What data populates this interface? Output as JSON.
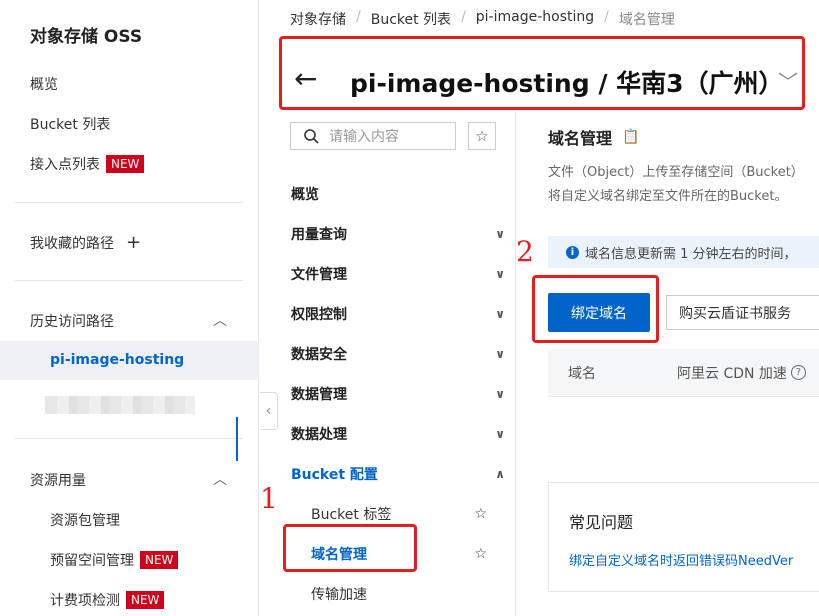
{
  "sidebar": {
    "title": "对象存储 OSS",
    "overview": "概览",
    "bucket_list": "Bucket 列表",
    "access_points": "接入点列表",
    "favorites": "我收藏的路径",
    "history": "历史访问路径",
    "history_active": "pi-image-hosting",
    "resource_usage": "资源用量",
    "resource_pack": "资源包管理",
    "reserved_space": "预留空间管理",
    "billing_check": "计费项检测",
    "new_badge": "NEW"
  },
  "breadcrumb": [
    "对象存储",
    "Bucket 列表",
    "pi-image-hosting",
    "域名管理"
  ],
  "header": {
    "title": "pi-image-hosting / 华南3（广州）"
  },
  "bucket_nav": {
    "search_placeholder": "请输入内容",
    "items": [
      {
        "label": "概览"
      },
      {
        "label": "用量查询"
      },
      {
        "label": "文件管理"
      },
      {
        "label": "权限控制"
      },
      {
        "label": "数据安全"
      },
      {
        "label": "数据管理"
      },
      {
        "label": "数据处理"
      },
      {
        "label": "Bucket 配置"
      }
    ],
    "subitems": [
      {
        "label": "Bucket 标签"
      },
      {
        "label": "域名管理"
      },
      {
        "label": "传输加速"
      }
    ]
  },
  "main": {
    "title": "域名管理",
    "desc_line1": "文件（Object）上传至存储空间（Bucket）",
    "desc_line2": "将自定义域名绑定至文件所在的Bucket。",
    "alert": "域名信息更新需 1 分钟左右的时间，",
    "bind_button": "绑定域名",
    "buy_cert_button": "购买云盾证书服务",
    "col_domain": "域名",
    "col_cdn": "阿里云 CDN 加速",
    "faq_title": "常见问题",
    "faq_link": "绑定自定义域名时返回错误码NeedVer"
  },
  "annotations": {
    "n1": "1",
    "n2": "2"
  }
}
